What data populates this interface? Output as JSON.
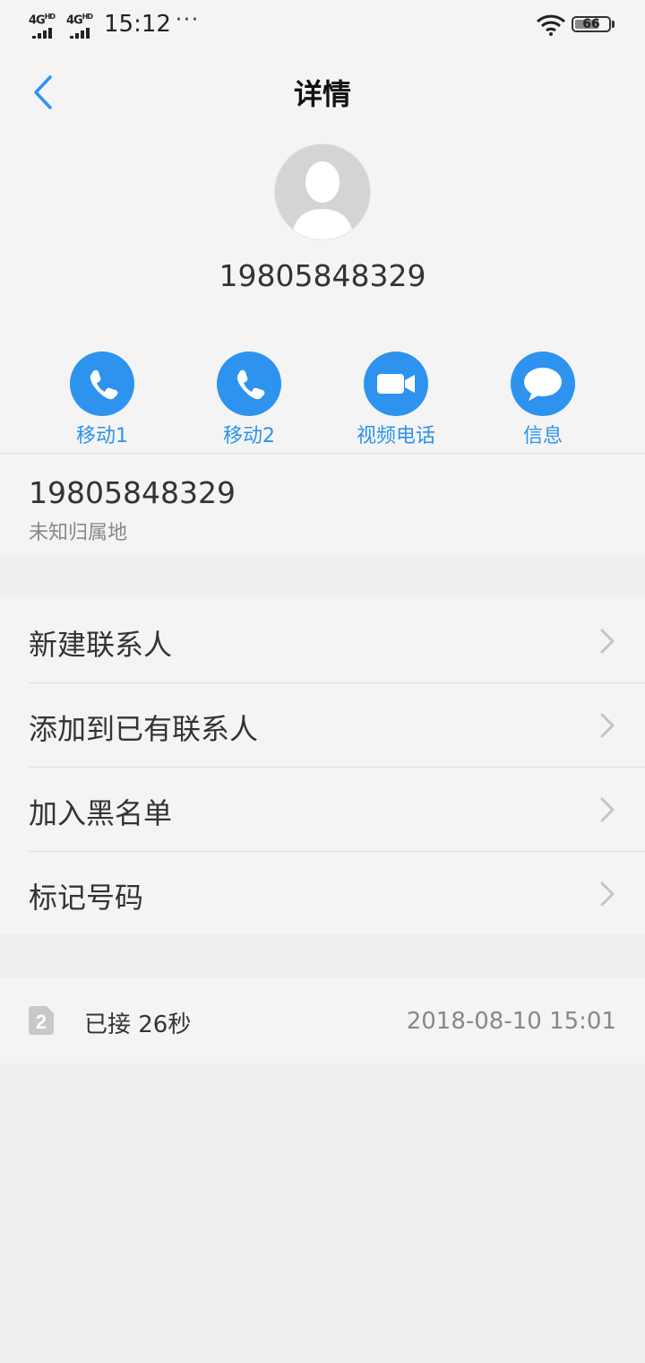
{
  "status_bar": {
    "network_1": "4G",
    "network_1_sup": "HD",
    "network_2": "4G",
    "network_2_sup": "HD",
    "time": "15:12",
    "more": "···",
    "battery": "66"
  },
  "header": {
    "title": "详情",
    "back_icon": "chevron-left-icon"
  },
  "contact": {
    "avatar_icon": "person-silhouette-icon",
    "number": "19805848329"
  },
  "actions": [
    {
      "label": "移动1",
      "icon": "phone-icon"
    },
    {
      "label": "移动2",
      "icon": "phone-icon"
    },
    {
      "label": "视频电话",
      "icon": "video-camera-icon"
    },
    {
      "label": "信息",
      "icon": "message-bubble-icon"
    }
  ],
  "number_info": {
    "number": "19805848329",
    "location": "未知归属地"
  },
  "menu": [
    {
      "label": "新建联系人"
    },
    {
      "label": "添加到已有联系人"
    },
    {
      "label": "加入黑名单"
    },
    {
      "label": "标记号码"
    }
  ],
  "call_log": {
    "sim": "2",
    "status": "已接 26秒",
    "timestamp": "2018-08-10 15:01"
  },
  "colors": {
    "accent": "#2d93ef",
    "background": "#f4f4f4",
    "secondary_text": "#888888"
  }
}
